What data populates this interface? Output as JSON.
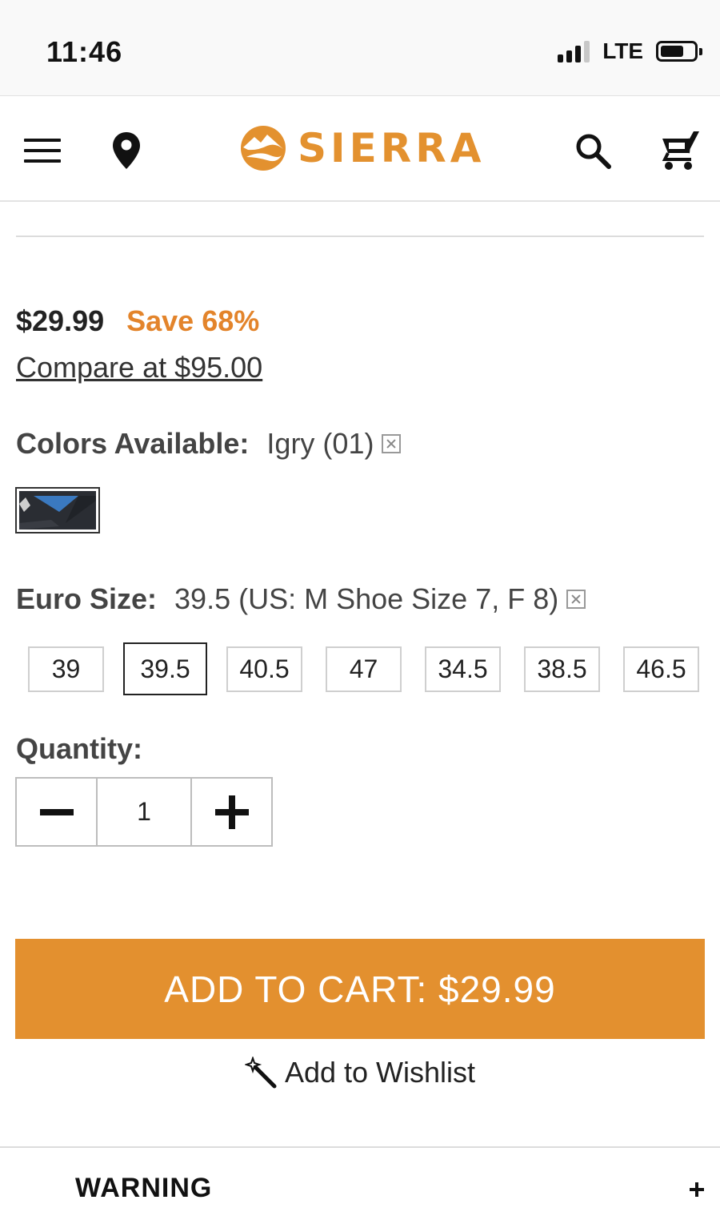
{
  "status_bar": {
    "time": "11:46",
    "network": "LTE",
    "icons": [
      "signal-icon",
      "battery-icon"
    ]
  },
  "header": {
    "logo_text": "SIERRA",
    "icons": [
      "menu-icon",
      "location-pin-icon",
      "search-icon",
      "cart-icon"
    ],
    "brand_color": "#e3912f"
  },
  "product": {
    "price": "$29.99",
    "save": "Save 68%",
    "compare": "Compare at $95.00",
    "colors": {
      "label": "Colors Available:",
      "selected": "Igry (01)"
    },
    "size": {
      "label": "Euro Size:",
      "selected": "39.5 (US: M Shoe Size 7, F 8)",
      "options": [
        "39",
        "39.5",
        "40.5",
        "47",
        "34.5",
        "38.5",
        "46.5"
      ],
      "selected_option": "39.5"
    },
    "quantity": {
      "label": "Quantity:",
      "value": "1"
    }
  },
  "actions": {
    "add_to_cart": "ADD TO CART: $29.99",
    "wishlist": "Add to Wishlist",
    "accent_color": "#e3902f"
  },
  "sections": {
    "warning": "WARNING"
  }
}
